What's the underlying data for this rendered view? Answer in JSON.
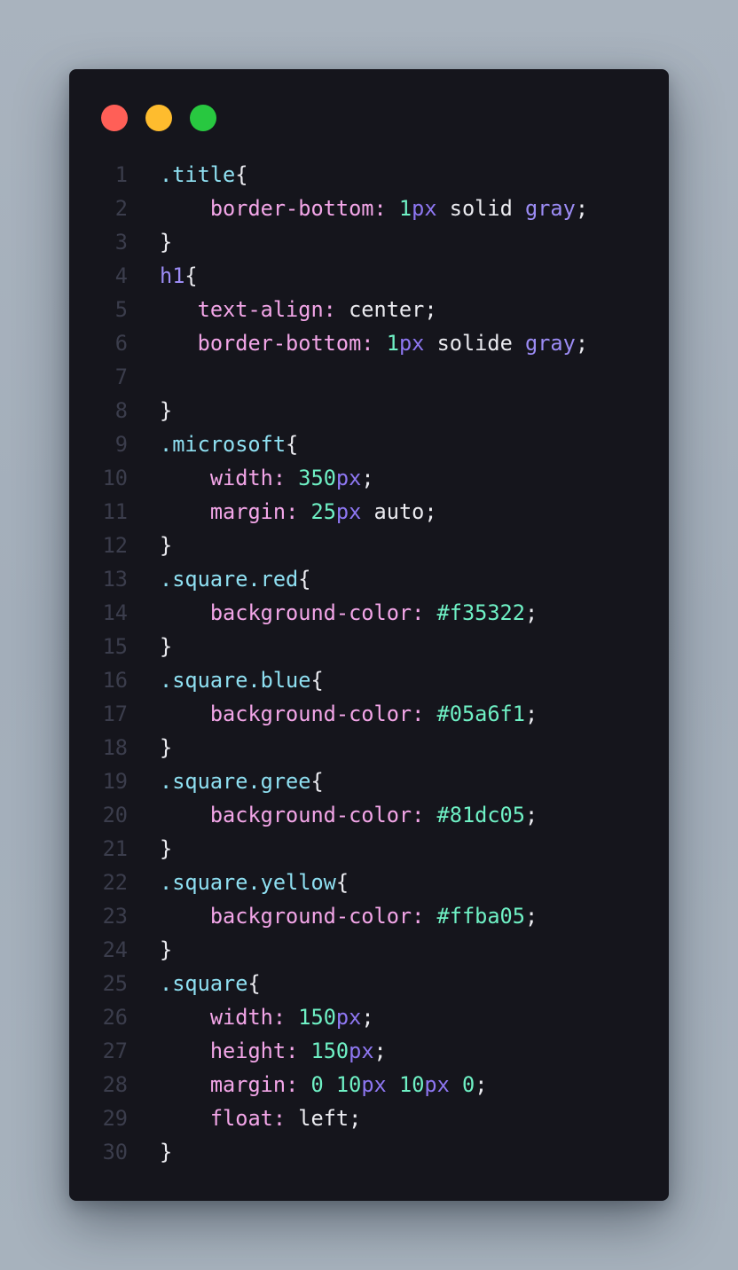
{
  "window": {
    "controls": [
      {
        "name": "close",
        "color": "#ff5f57"
      },
      {
        "name": "minimize",
        "color": "#febc2e"
      },
      {
        "name": "maximize",
        "color": "#28c840"
      }
    ]
  },
  "editor": {
    "language": "css",
    "lines": [
      {
        "n": "1",
        "indent": "",
        "tokens": [
          {
            "t": ".title",
            "c": "sel"
          },
          {
            "t": "{",
            "c": "punct"
          }
        ]
      },
      {
        "n": "2",
        "indent": "    ",
        "tokens": [
          {
            "t": "border-bottom",
            "c": "prop"
          },
          {
            "t": ": ",
            "c": "prop"
          },
          {
            "t": "1",
            "c": "num"
          },
          {
            "t": "px",
            "c": "unit"
          },
          {
            "t": " solid ",
            "c": "val"
          },
          {
            "t": "gray",
            "c": "kw"
          },
          {
            "t": ";",
            "c": "punct"
          }
        ]
      },
      {
        "n": "3",
        "indent": "",
        "tokens": [
          {
            "t": "}",
            "c": "punct"
          }
        ]
      },
      {
        "n": "4",
        "indent": "",
        "tokens": [
          {
            "t": "h1",
            "c": "tag"
          },
          {
            "t": "{",
            "c": "punct"
          }
        ]
      },
      {
        "n": "5",
        "indent": "   ",
        "tokens": [
          {
            "t": "text-align",
            "c": "prop"
          },
          {
            "t": ": ",
            "c": "prop"
          },
          {
            "t": "center",
            "c": "val"
          },
          {
            "t": ";",
            "c": "punct"
          }
        ]
      },
      {
        "n": "6",
        "indent": "   ",
        "tokens": [
          {
            "t": "border-bottom",
            "c": "prop"
          },
          {
            "t": ": ",
            "c": "prop"
          },
          {
            "t": "1",
            "c": "num"
          },
          {
            "t": "px",
            "c": "unit"
          },
          {
            "t": " solide ",
            "c": "val"
          },
          {
            "t": "gray",
            "c": "kw"
          },
          {
            "t": ";",
            "c": "punct"
          }
        ]
      },
      {
        "n": "7",
        "indent": "",
        "tokens": []
      },
      {
        "n": "8",
        "indent": "",
        "tokens": [
          {
            "t": "}",
            "c": "punct"
          }
        ]
      },
      {
        "n": "9",
        "indent": "",
        "tokens": [
          {
            "t": ".microsoft",
            "c": "sel"
          },
          {
            "t": "{",
            "c": "punct"
          }
        ]
      },
      {
        "n": "10",
        "indent": "    ",
        "tokens": [
          {
            "t": "width",
            "c": "prop"
          },
          {
            "t": ": ",
            "c": "prop"
          },
          {
            "t": "350",
            "c": "num"
          },
          {
            "t": "px",
            "c": "unit"
          },
          {
            "t": ";",
            "c": "punct"
          }
        ]
      },
      {
        "n": "11",
        "indent": "    ",
        "tokens": [
          {
            "t": "margin",
            "c": "prop"
          },
          {
            "t": ": ",
            "c": "prop"
          },
          {
            "t": "25",
            "c": "num"
          },
          {
            "t": "px",
            "c": "unit"
          },
          {
            "t": " auto",
            "c": "val"
          },
          {
            "t": ";",
            "c": "punct"
          }
        ]
      },
      {
        "n": "12",
        "indent": "",
        "tokens": [
          {
            "t": "}",
            "c": "punct"
          }
        ]
      },
      {
        "n": "13",
        "indent": "",
        "tokens": [
          {
            "t": ".square.red",
            "c": "sel"
          },
          {
            "t": "{",
            "c": "punct"
          }
        ]
      },
      {
        "n": "14",
        "indent": "    ",
        "tokens": [
          {
            "t": "background-color",
            "c": "prop"
          },
          {
            "t": ": ",
            "c": "prop"
          },
          {
            "t": "#f35322",
            "c": "num"
          },
          {
            "t": ";",
            "c": "punct"
          }
        ]
      },
      {
        "n": "15",
        "indent": "",
        "tokens": [
          {
            "t": "}",
            "c": "punct"
          }
        ]
      },
      {
        "n": "16",
        "indent": "",
        "tokens": [
          {
            "t": ".square.blue",
            "c": "sel"
          },
          {
            "t": "{",
            "c": "punct"
          }
        ]
      },
      {
        "n": "17",
        "indent": "    ",
        "tokens": [
          {
            "t": "background-color",
            "c": "prop"
          },
          {
            "t": ": ",
            "c": "prop"
          },
          {
            "t": "#05a6f1",
            "c": "num"
          },
          {
            "t": ";",
            "c": "punct"
          }
        ]
      },
      {
        "n": "18",
        "indent": "",
        "tokens": [
          {
            "t": "}",
            "c": "punct"
          }
        ]
      },
      {
        "n": "19",
        "indent": "",
        "tokens": [
          {
            "t": ".square.gree",
            "c": "sel"
          },
          {
            "t": "{",
            "c": "punct"
          }
        ]
      },
      {
        "n": "20",
        "indent": "    ",
        "tokens": [
          {
            "t": "background-color",
            "c": "prop"
          },
          {
            "t": ": ",
            "c": "prop"
          },
          {
            "t": "#81dc05",
            "c": "num"
          },
          {
            "t": ";",
            "c": "punct"
          }
        ]
      },
      {
        "n": "21",
        "indent": "",
        "tokens": [
          {
            "t": "}",
            "c": "punct"
          }
        ]
      },
      {
        "n": "22",
        "indent": "",
        "tokens": [
          {
            "t": ".square.yellow",
            "c": "sel"
          },
          {
            "t": "{",
            "c": "punct"
          }
        ]
      },
      {
        "n": "23",
        "indent": "    ",
        "tokens": [
          {
            "t": "background-color",
            "c": "prop"
          },
          {
            "t": ": ",
            "c": "prop"
          },
          {
            "t": "#ffba05",
            "c": "num"
          },
          {
            "t": ";",
            "c": "punct"
          }
        ]
      },
      {
        "n": "24",
        "indent": "",
        "tokens": [
          {
            "t": "}",
            "c": "punct"
          }
        ]
      },
      {
        "n": "25",
        "indent": "",
        "tokens": [
          {
            "t": ".square",
            "c": "sel"
          },
          {
            "t": "{",
            "c": "punct"
          }
        ]
      },
      {
        "n": "26",
        "indent": "    ",
        "tokens": [
          {
            "t": "width",
            "c": "prop"
          },
          {
            "t": ": ",
            "c": "prop"
          },
          {
            "t": "150",
            "c": "num"
          },
          {
            "t": "px",
            "c": "unit"
          },
          {
            "t": ";",
            "c": "punct"
          }
        ]
      },
      {
        "n": "27",
        "indent": "    ",
        "tokens": [
          {
            "t": "height",
            "c": "prop"
          },
          {
            "t": ": ",
            "c": "prop"
          },
          {
            "t": "150",
            "c": "num"
          },
          {
            "t": "px",
            "c": "unit"
          },
          {
            "t": ";",
            "c": "punct"
          }
        ]
      },
      {
        "n": "28",
        "indent": "    ",
        "tokens": [
          {
            "t": "margin",
            "c": "prop"
          },
          {
            "t": ": ",
            "c": "prop"
          },
          {
            "t": "0",
            "c": "num"
          },
          {
            "t": " ",
            "c": "val"
          },
          {
            "t": "10",
            "c": "num"
          },
          {
            "t": "px",
            "c": "unit"
          },
          {
            "t": " ",
            "c": "val"
          },
          {
            "t": "10",
            "c": "num"
          },
          {
            "t": "px",
            "c": "unit"
          },
          {
            "t": " ",
            "c": "val"
          },
          {
            "t": "0",
            "c": "num"
          },
          {
            "t": ";",
            "c": "punct"
          }
        ]
      },
      {
        "n": "29",
        "indent": "    ",
        "tokens": [
          {
            "t": "float",
            "c": "prop"
          },
          {
            "t": ": ",
            "c": "prop"
          },
          {
            "t": "left",
            "c": "val"
          },
          {
            "t": ";",
            "c": "punct"
          }
        ]
      },
      {
        "n": "30",
        "indent": "",
        "tokens": [
          {
            "t": "}",
            "c": "punct"
          }
        ]
      }
    ]
  }
}
